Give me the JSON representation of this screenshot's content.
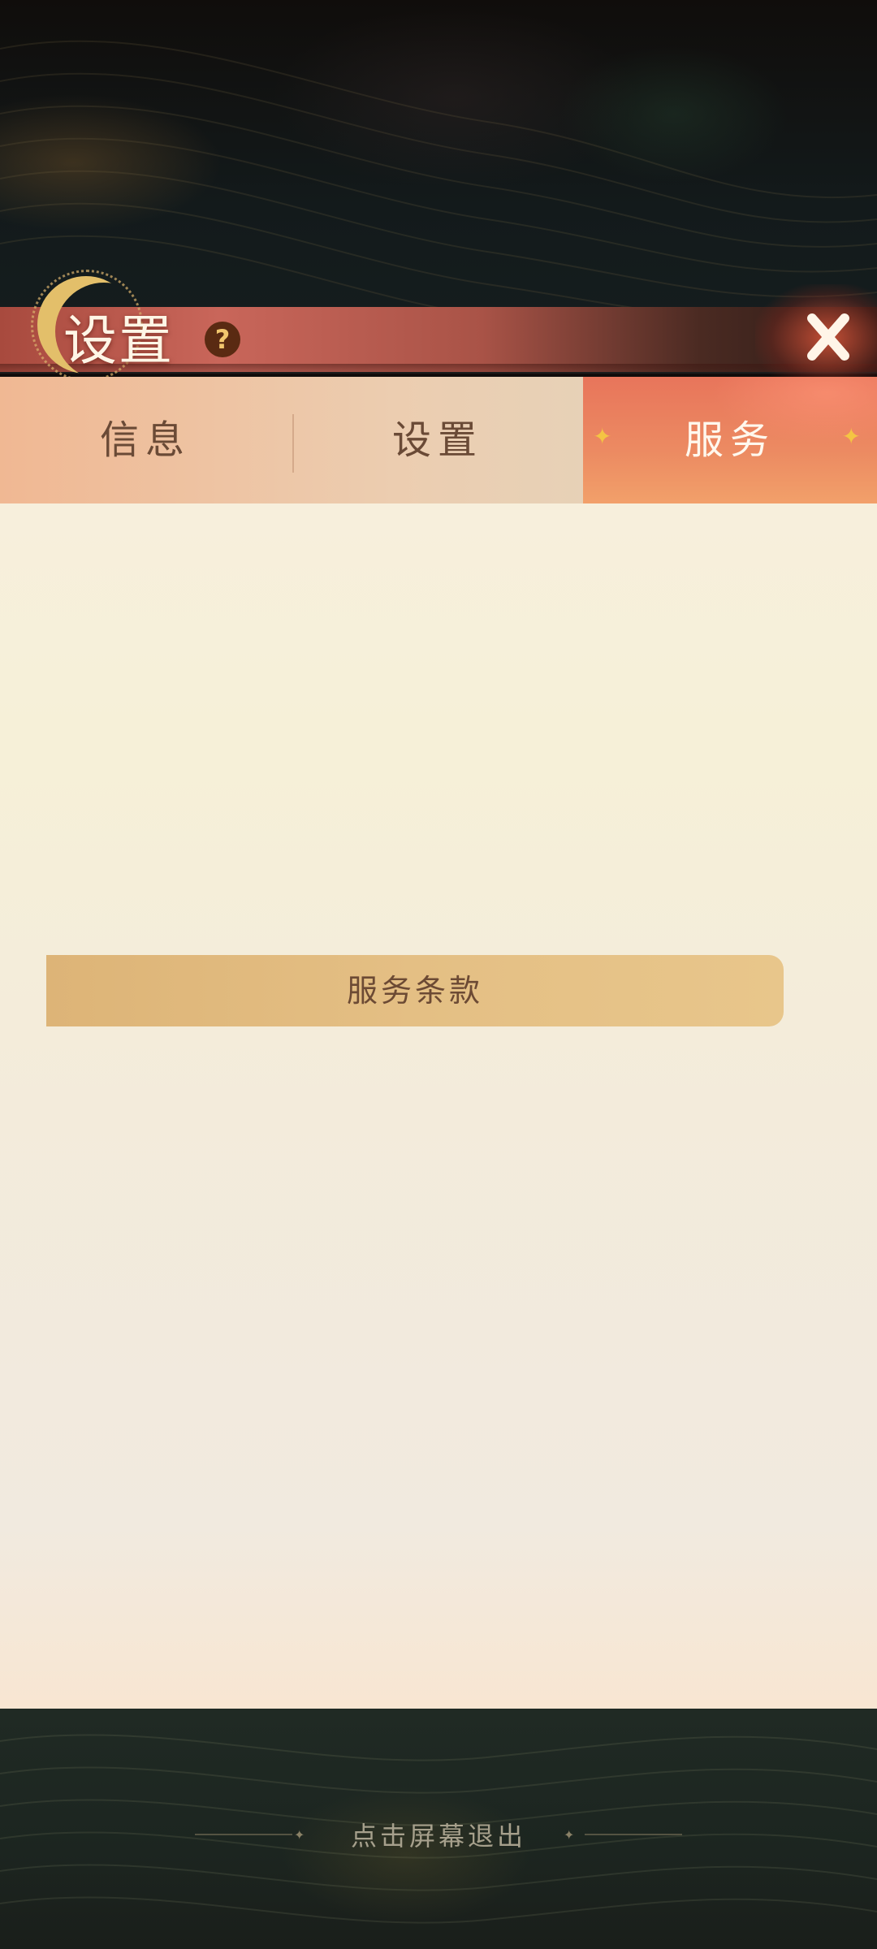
{
  "header": {
    "title": "设置",
    "help_icon": "?"
  },
  "tabs": [
    {
      "label": "信息",
      "active": false
    },
    {
      "label": "设置",
      "active": false
    },
    {
      "label": "服务",
      "active": true
    }
  ],
  "main": {
    "terms_button_label": "服务条款"
  },
  "footer": {
    "exit_hint": "点击屏幕退出"
  },
  "colors": {
    "active_tab": "#ec8b62",
    "header_bar": "#c9665a",
    "panel_bg": "#f6f0d8",
    "terms_button": "#e4bf84"
  }
}
